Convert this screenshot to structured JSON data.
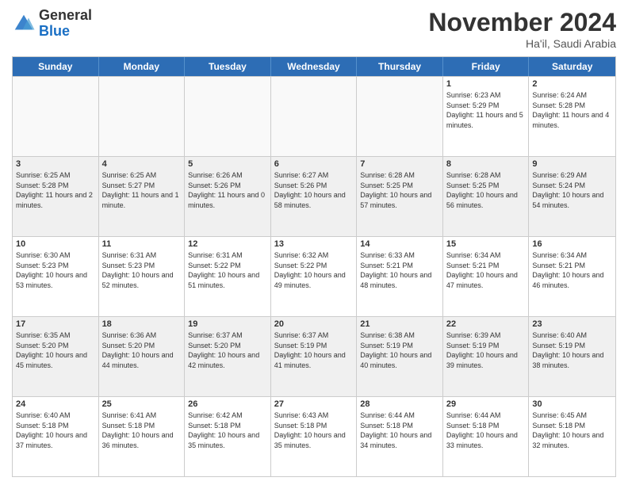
{
  "logo": {
    "general": "General",
    "blue": "Blue"
  },
  "header": {
    "month": "November 2024",
    "location": "Ha'il, Saudi Arabia"
  },
  "days": [
    "Sunday",
    "Monday",
    "Tuesday",
    "Wednesday",
    "Thursday",
    "Friday",
    "Saturday"
  ],
  "weeks": [
    [
      {
        "day": "",
        "empty": true
      },
      {
        "day": "",
        "empty": true
      },
      {
        "day": "",
        "empty": true
      },
      {
        "day": "",
        "empty": true
      },
      {
        "day": "",
        "empty": true
      },
      {
        "day": "1",
        "sunrise": "6:23 AM",
        "sunset": "5:29 PM",
        "daylight": "11 hours and 5 minutes."
      },
      {
        "day": "2",
        "sunrise": "6:24 AM",
        "sunset": "5:28 PM",
        "daylight": "11 hours and 4 minutes."
      }
    ],
    [
      {
        "day": "3",
        "sunrise": "6:25 AM",
        "sunset": "5:28 PM",
        "daylight": "11 hours and 2 minutes."
      },
      {
        "day": "4",
        "sunrise": "6:25 AM",
        "sunset": "5:27 PM",
        "daylight": "11 hours and 1 minute."
      },
      {
        "day": "5",
        "sunrise": "6:26 AM",
        "sunset": "5:26 PM",
        "daylight": "11 hours and 0 minutes."
      },
      {
        "day": "6",
        "sunrise": "6:27 AM",
        "sunset": "5:26 PM",
        "daylight": "10 hours and 58 minutes."
      },
      {
        "day": "7",
        "sunrise": "6:28 AM",
        "sunset": "5:25 PM",
        "daylight": "10 hours and 57 minutes."
      },
      {
        "day": "8",
        "sunrise": "6:28 AM",
        "sunset": "5:25 PM",
        "daylight": "10 hours and 56 minutes."
      },
      {
        "day": "9",
        "sunrise": "6:29 AM",
        "sunset": "5:24 PM",
        "daylight": "10 hours and 54 minutes."
      }
    ],
    [
      {
        "day": "10",
        "sunrise": "6:30 AM",
        "sunset": "5:23 PM",
        "daylight": "10 hours and 53 minutes."
      },
      {
        "day": "11",
        "sunrise": "6:31 AM",
        "sunset": "5:23 PM",
        "daylight": "10 hours and 52 minutes."
      },
      {
        "day": "12",
        "sunrise": "6:31 AM",
        "sunset": "5:22 PM",
        "daylight": "10 hours and 51 minutes."
      },
      {
        "day": "13",
        "sunrise": "6:32 AM",
        "sunset": "5:22 PM",
        "daylight": "10 hours and 49 minutes."
      },
      {
        "day": "14",
        "sunrise": "6:33 AM",
        "sunset": "5:21 PM",
        "daylight": "10 hours and 48 minutes."
      },
      {
        "day": "15",
        "sunrise": "6:34 AM",
        "sunset": "5:21 PM",
        "daylight": "10 hours and 47 minutes."
      },
      {
        "day": "16",
        "sunrise": "6:34 AM",
        "sunset": "5:21 PM",
        "daylight": "10 hours and 46 minutes."
      }
    ],
    [
      {
        "day": "17",
        "sunrise": "6:35 AM",
        "sunset": "5:20 PM",
        "daylight": "10 hours and 45 minutes."
      },
      {
        "day": "18",
        "sunrise": "6:36 AM",
        "sunset": "5:20 PM",
        "daylight": "10 hours and 44 minutes."
      },
      {
        "day": "19",
        "sunrise": "6:37 AM",
        "sunset": "5:20 PM",
        "daylight": "10 hours and 42 minutes."
      },
      {
        "day": "20",
        "sunrise": "6:37 AM",
        "sunset": "5:19 PM",
        "daylight": "10 hours and 41 minutes."
      },
      {
        "day": "21",
        "sunrise": "6:38 AM",
        "sunset": "5:19 PM",
        "daylight": "10 hours and 40 minutes."
      },
      {
        "day": "22",
        "sunrise": "6:39 AM",
        "sunset": "5:19 PM",
        "daylight": "10 hours and 39 minutes."
      },
      {
        "day": "23",
        "sunrise": "6:40 AM",
        "sunset": "5:19 PM",
        "daylight": "10 hours and 38 minutes."
      }
    ],
    [
      {
        "day": "24",
        "sunrise": "6:40 AM",
        "sunset": "5:18 PM",
        "daylight": "10 hours and 37 minutes."
      },
      {
        "day": "25",
        "sunrise": "6:41 AM",
        "sunset": "5:18 PM",
        "daylight": "10 hours and 36 minutes."
      },
      {
        "day": "26",
        "sunrise": "6:42 AM",
        "sunset": "5:18 PM",
        "daylight": "10 hours and 35 minutes."
      },
      {
        "day": "27",
        "sunrise": "6:43 AM",
        "sunset": "5:18 PM",
        "daylight": "10 hours and 35 minutes."
      },
      {
        "day": "28",
        "sunrise": "6:44 AM",
        "sunset": "5:18 PM",
        "daylight": "10 hours and 34 minutes."
      },
      {
        "day": "29",
        "sunrise": "6:44 AM",
        "sunset": "5:18 PM",
        "daylight": "10 hours and 33 minutes."
      },
      {
        "day": "30",
        "sunrise": "6:45 AM",
        "sunset": "5:18 PM",
        "daylight": "10 hours and 32 minutes."
      }
    ]
  ]
}
